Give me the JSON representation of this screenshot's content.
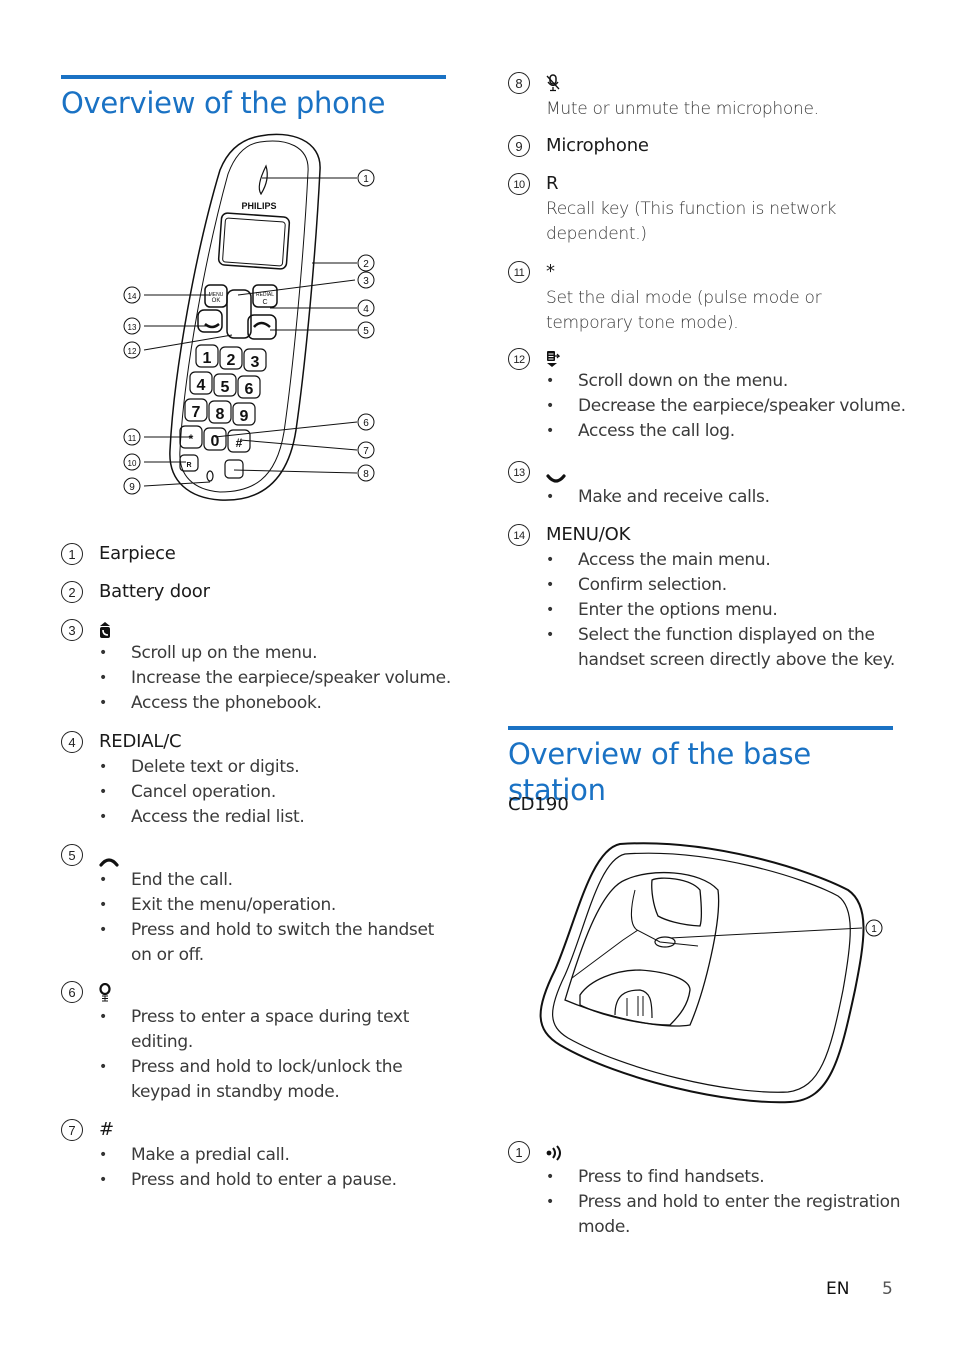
{
  "left_column": {
    "section_title": "Overview of the phone",
    "figure": {
      "brand_label": "PHILIPS",
      "callout_numbers": [
        "1",
        "2",
        "3",
        "4",
        "5",
        "6",
        "7",
        "8",
        "9",
        "10",
        "11",
        "12",
        "13",
        "14"
      ],
      "keys": {
        "menu_top": "MENU",
        "menu_bottom": "OK",
        "redial_top": "REDIAL",
        "redial_bottom": "C",
        "digits": [
          "1",
          "2",
          "3",
          "4",
          "5",
          "6",
          "7",
          "8",
          "9",
          "*",
          "0",
          "#"
        ],
        "recall": "R"
      }
    },
    "items": [
      {
        "num": "1",
        "title": "Earpiece"
      },
      {
        "num": "2",
        "title": "Battery door"
      },
      {
        "num": "3",
        "icon": "phonebook-up-icon",
        "bullets": [
          "Scroll up on the menu.",
          "Increase the earpiece/speaker volume.",
          "Access the phonebook."
        ]
      },
      {
        "num": "4",
        "title": "REDIAL/C",
        "bullets": [
          "Delete text or digits.",
          "Cancel operation.",
          "Access the redial list."
        ]
      },
      {
        "num": "5",
        "icon": "end-call-icon",
        "bullets": [
          "End the call.",
          "Exit the menu/operation.",
          "Press and hold to switch the handset",
          "on or off."
        ]
      },
      {
        "num": "6",
        "icon": "zero-key-lock-icon",
        "bullets": [
          "Press to enter a space during text",
          "editing.",
          "Press and hold to lock/unlock the",
          "keypad in standby mode."
        ]
      },
      {
        "num": "7",
        "title": "#",
        "bullets": [
          "Make a predial call.",
          "Press and hold to enter a pause."
        ]
      }
    ]
  },
  "right_column": {
    "items": [
      {
        "num": "8",
        "icon": "mute-microphone-icon",
        "desc": [
          "Mute or unmute the microphone."
        ]
      },
      {
        "num": "9",
        "title": "Microphone"
      },
      {
        "num": "10",
        "title": "R",
        "desc": [
          "Recall key (This function is network",
          "dependent.)"
        ]
      },
      {
        "num": "11",
        "title": "*",
        "desc": [
          "Set the dial mode (pulse mode or",
          "temporary tone mode)."
        ]
      },
      {
        "num": "12",
        "icon": "call-log-down-icon",
        "bullets": [
          "Scroll down on the menu.",
          "Decrease the earpiece/speaker volume.",
          "Access the call log."
        ]
      },
      {
        "num": "13",
        "icon": "talk-icon",
        "bullets": [
          "Make and receive calls."
        ]
      },
      {
        "num": "14",
        "title": "MENU/OK",
        "bullets": [
          "Access the main menu.",
          "Confirm selection.",
          "Enter the options menu.",
          "Select the function displayed on the",
          "handset screen directly above the key."
        ]
      }
    ],
    "base_section": {
      "section_title": "Overview of the base station",
      "model": "CD190",
      "figure_callout": "1",
      "items": [
        {
          "num": "1",
          "icon": "paging-icon",
          "bullets": [
            "Press to find handsets.",
            "Press and hold to enter the registration",
            "mode."
          ]
        }
      ]
    }
  },
  "footer": {
    "language": "EN",
    "page_number": "5"
  }
}
